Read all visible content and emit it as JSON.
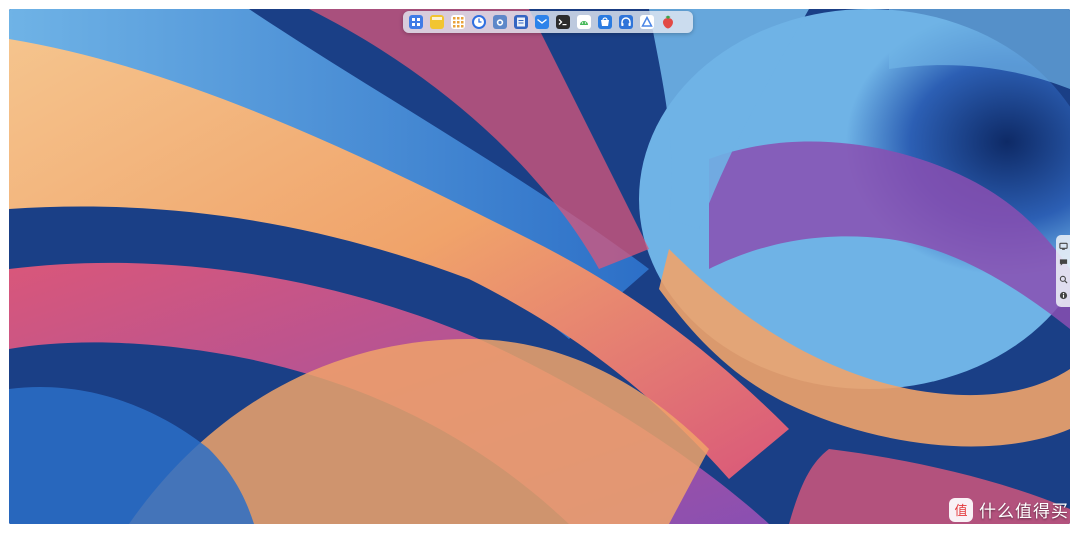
{
  "desktop": {
    "wallpaper_colors": [
      "#1a3f86",
      "#2c6fc7",
      "#6fb3e6",
      "#f0a36a",
      "#f5c48d",
      "#d9577a",
      "#8a4fb2",
      "#0e2a66"
    ]
  },
  "dock": {
    "apps": [
      {
        "name": "launcher-icon",
        "color": "#3f7be6"
      },
      {
        "name": "notes-icon",
        "color": "#f2c531"
      },
      {
        "name": "app-grid-icon",
        "color": "#e9a23b"
      },
      {
        "name": "clock-icon",
        "color": "#2f6fe0"
      },
      {
        "name": "camera-icon",
        "color": "#5e87c9"
      },
      {
        "name": "files-icon",
        "color": "#3565c2"
      },
      {
        "name": "mail-icon",
        "color": "#2d83ea"
      },
      {
        "name": "terminal-icon",
        "color": "#2b2b2b"
      },
      {
        "name": "android-icon",
        "color": "#47b85a"
      },
      {
        "name": "app-store-icon",
        "color": "#2b7be0"
      },
      {
        "name": "headphones-icon",
        "color": "#2f74d9"
      },
      {
        "name": "triangle-app-icon",
        "color": "#4c86e6"
      },
      {
        "name": "strawberry-icon",
        "color": "#e24a45"
      }
    ]
  },
  "sidebar": {
    "buttons": [
      "monitor-icon",
      "chat-icon",
      "search-icon",
      "info-icon"
    ]
  },
  "watermark": {
    "text": "什么值得买",
    "logo_char": "值"
  }
}
